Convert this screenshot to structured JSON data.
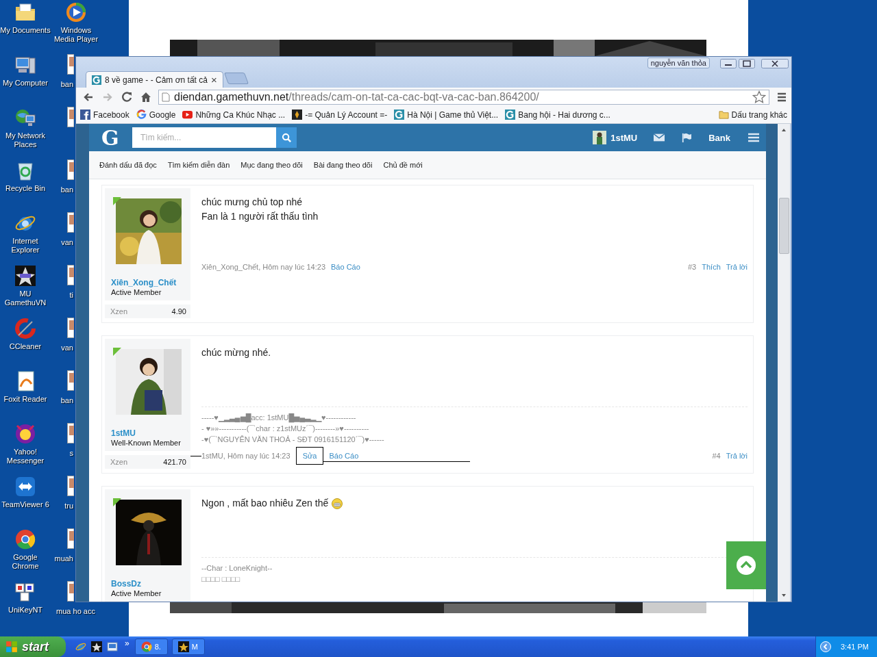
{
  "desktop": {
    "icons": [
      {
        "label": "My Documents",
        "kind": "folder"
      },
      {
        "label": "My Computer",
        "kind": "computer"
      },
      {
        "label": "My Network Places",
        "kind": "network"
      },
      {
        "label": "Recycle Bin",
        "kind": "recycle"
      },
      {
        "label": "Internet Explorer",
        "kind": "ie"
      },
      {
        "label": "MU GamethuVN",
        "kind": "mu"
      },
      {
        "label": "CCleaner",
        "kind": "ccleaner"
      },
      {
        "label": "Foxit Reader",
        "kind": "pdf"
      },
      {
        "label": "Yahoo! Messenger",
        "kind": "yahoo"
      },
      {
        "label": "TeamViewer 6",
        "kind": "teamviewer"
      },
      {
        "label": "Google Chrome",
        "kind": "chrome"
      },
      {
        "label": "UniKeyNT",
        "kind": "unikey"
      }
    ],
    "icons_column_2": [
      {
        "label": "Windows Media Player",
        "kind": "media"
      },
      {
        "label": "ban",
        "kind": "file"
      },
      {
        "kind": "file"
      },
      {
        "label": "ban",
        "kind": "file"
      },
      {
        "label": "van",
        "kind": "file"
      },
      {
        "label": "ti",
        "kind": "file"
      },
      {
        "label": "van",
        "kind": "file"
      },
      {
        "label": "ban",
        "kind": "file"
      },
      {
        "label": "s",
        "kind": "file"
      },
      {
        "label": "tru",
        "kind": "file"
      },
      {
        "label": "muah",
        "kind": "file"
      },
      {
        "label": "mua ho acc",
        "kind": "file"
      }
    ]
  },
  "browser": {
    "profile": "nguyễn văn thỏa",
    "tabs": [
      {
        "title": "8 về game - - Cảm ơn tất cả",
        "selected": true,
        "close": "×"
      }
    ],
    "address": {
      "host": "diendan.gamethuvn.net",
      "path": "/threads/cam-on-tat-ca-cac-bqt-va-cac-ban.864200/"
    },
    "bookmarks": [
      {
        "label": "Facebook",
        "kind": "blue"
      },
      {
        "label": "Google",
        "kind": "ring"
      },
      {
        "label": "Những Ca Khúc Nhạc ...",
        "kind": "play"
      },
      {
        "label": "-= Quản Lý Account =-",
        "kind": "dark"
      },
      {
        "label": "Hà Nội | Game thủ Việt...",
        "kind": "teal"
      },
      {
        "label": "Bang hội - Hai dương c...",
        "kind": "teal"
      }
    ],
    "other_bookmarks": "Dấu trang khác",
    "page": {
      "logo": "G",
      "search": {
        "placeholder": "Tìm kiếm..."
      },
      "user": "1stMU",
      "bank": "Bank",
      "nav": [
        "Đánh dấu đã đọc",
        "Tìm kiếm diễn đàn",
        "Mục đang theo dõi",
        "Bài đang theo dõi",
        "Chủ đề mới"
      ],
      "posts": [
        {
          "author": "Xiên_Xong_Chết",
          "title": "Active Member",
          "xzen_label": "Xzen",
          "xzen": "4.90",
          "lines": [
            "chúc mưng chủ top nhé",
            "Fan là 1 người rất thấu tình"
          ],
          "smiley": false,
          "byline": "Xiên_Xong_Chết, Hôm nay lúc 14:23",
          "links": [
            "Báo Cáo"
          ],
          "number": "#3",
          "actions": [
            "Thích",
            "Trả lời"
          ],
          "annotation": false
        },
        {
          "author": "1stMU",
          "title": "Well-Known Member",
          "xzen_label": "Xzen",
          "xzen": "421.70",
          "lines": [
            "chúc mừng nhé."
          ],
          "smiley": false,
          "signature": [
            "-----♥▁▂▃▄▅█acc: 1stMU█▅▄▃▂▁♥------------",
            "- ♥»»-----------(¯`char : z1stMUz´¯)--------»♥----------",
            "-♥(¯`NGUYỄN VĂN THOẢ - SĐT 0916151120´¯)♥------"
          ],
          "byline": "1stMU, Hôm nay lúc 14:23",
          "links": [
            "Sửa",
            "Báo Cáo"
          ],
          "number": "#4",
          "actions": [
            "Trả lời"
          ],
          "annotation": true
        },
        {
          "author": "BossDz",
          "title": "Active Member",
          "lines": [
            "Ngon , mất bao nhiêu Zen thế"
          ],
          "smiley": true,
          "signature": [
            "--Char : LoneKnight--",
            "□□□□ □□□□"
          ]
        }
      ]
    }
  },
  "taskbar": {
    "start": "start",
    "more": "»",
    "tasks": [
      {
        "label": "8.",
        "kind": "chrome"
      },
      {
        "label": "M",
        "kind": "mu"
      }
    ],
    "clock": "3:41 PM"
  }
}
